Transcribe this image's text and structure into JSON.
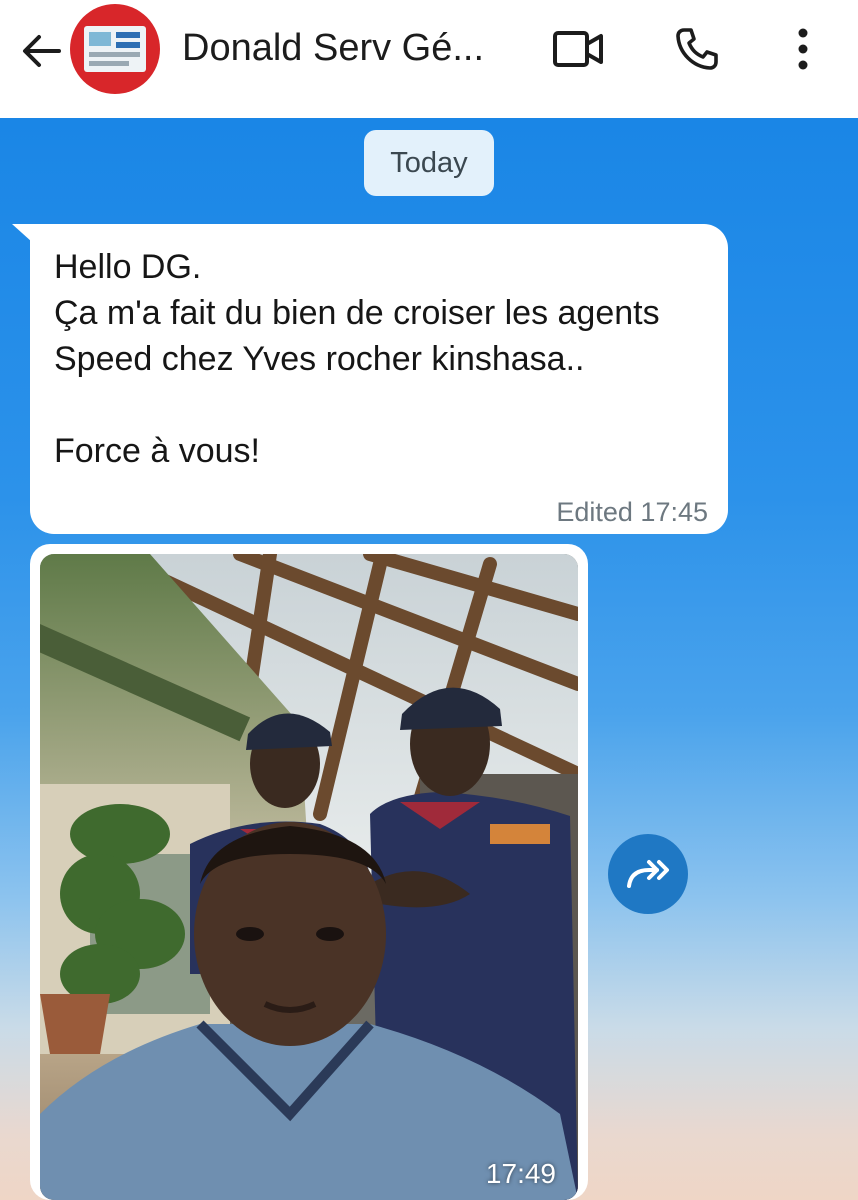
{
  "header": {
    "back_icon": "arrow-left-icon",
    "contact_name": "Donald Serv Gé...",
    "video_icon": "video-camera-icon",
    "call_icon": "phone-icon",
    "menu_icon": "more-vertical-icon"
  },
  "chat": {
    "date_label": "Today",
    "messages": [
      {
        "type": "text",
        "text": "Hello DG.\nÇa m'a fait du bien de croiser les agents Speed chez Yves rocher kinshasa..\n\nForce à vous!",
        "meta": "Edited 17:45"
      },
      {
        "type": "image",
        "time": "17:49",
        "forward_icon": "forward-icon"
      }
    ]
  },
  "colors": {
    "accent": "#1f78c4",
    "chat_bg_top": "#1a86e6",
    "chat_bg_bottom": "#efd6c6",
    "bubble": "#ffffff"
  }
}
